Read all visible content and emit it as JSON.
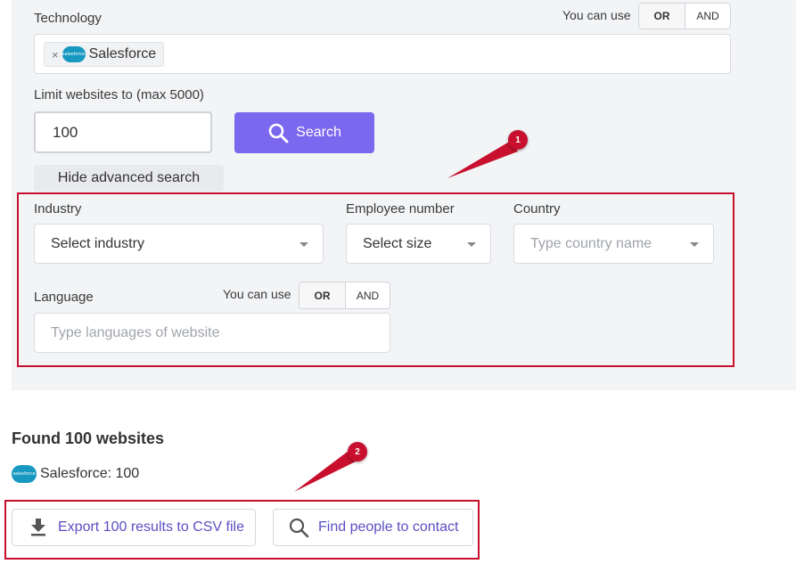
{
  "technology": {
    "label": "Technology",
    "you_can_use": "You can use",
    "or_label": "OR",
    "and_label": "AND",
    "chip_remove": "×",
    "chip_logo_text": "salesforce",
    "chip_label": "Salesforce"
  },
  "limit": {
    "label": "Limit websites to (max 5000)",
    "value": "100"
  },
  "search_button": {
    "label": "Search"
  },
  "hide_advanced": {
    "label": "Hide advanced search"
  },
  "advanced": {
    "industry": {
      "label": "Industry",
      "value": "Select industry"
    },
    "employees": {
      "label": "Employee number",
      "value": "Select size"
    },
    "country": {
      "label": "Country",
      "placeholder": "Type country name"
    },
    "language": {
      "label": "Language",
      "you_can_use": "You can use",
      "or_label": "OR",
      "and_label": "AND",
      "placeholder": "Type languages of website"
    }
  },
  "results": {
    "heading": "Found 100 websites",
    "logo_text": "salesforce",
    "summary": "Salesforce: 100",
    "export_label": "Export 100 results to CSV file",
    "find_people_label": "Find people to contact"
  },
  "annotations": {
    "badge_1": "1",
    "badge_2": "2"
  },
  "colors": {
    "accent": "#7b68ee",
    "link": "#5b4fc4",
    "annotation_red": "#c8102e",
    "salesforce_blue": "#1798c1"
  }
}
